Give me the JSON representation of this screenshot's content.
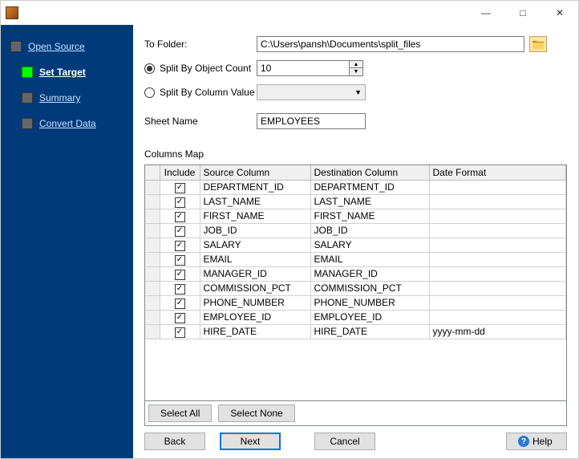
{
  "window": {
    "min": "—",
    "max": "□",
    "close": "✕"
  },
  "nav": {
    "items": [
      {
        "label": "Open Source"
      },
      {
        "label": "Set Target"
      },
      {
        "label": "Summary"
      },
      {
        "label": "Convert Data"
      }
    ],
    "active_index": 1
  },
  "form": {
    "to_folder_label": "To Folder:",
    "to_folder_value": "C:\\Users\\pansh\\Documents\\split_files",
    "split_count_label": "Split By Object Count",
    "split_count_value": "10",
    "split_column_label": "Split By Column Value",
    "sheet_name_label": "Sheet Name",
    "sheet_name_value": "EMPLOYEES"
  },
  "columns_map": {
    "heading": "Columns Map",
    "headers": {
      "include": "Include",
      "source": "Source Column",
      "dest": "Destination Column",
      "date": "Date Format"
    },
    "rows": [
      {
        "source": "DEPARTMENT_ID",
        "dest": "DEPARTMENT_ID",
        "date": ""
      },
      {
        "source": "LAST_NAME",
        "dest": "LAST_NAME",
        "date": ""
      },
      {
        "source": "FIRST_NAME",
        "dest": "FIRST_NAME",
        "date": ""
      },
      {
        "source": "JOB_ID",
        "dest": "JOB_ID",
        "date": ""
      },
      {
        "source": "SALARY",
        "dest": "SALARY",
        "date": ""
      },
      {
        "source": "EMAIL",
        "dest": "EMAIL",
        "date": ""
      },
      {
        "source": "MANAGER_ID",
        "dest": "MANAGER_ID",
        "date": ""
      },
      {
        "source": "COMMISSION_PCT",
        "dest": "COMMISSION_PCT",
        "date": ""
      },
      {
        "source": "PHONE_NUMBER",
        "dest": "PHONE_NUMBER",
        "date": ""
      },
      {
        "source": "EMPLOYEE_ID",
        "dest": "EMPLOYEE_ID",
        "date": ""
      },
      {
        "source": "HIRE_DATE",
        "dest": "HIRE_DATE",
        "date": "yyyy-mm-dd"
      }
    ]
  },
  "buttons": {
    "select_all": "Select All",
    "select_none": "Select None",
    "back": "Back",
    "next": "Next",
    "cancel": "Cancel",
    "help": "Help"
  }
}
